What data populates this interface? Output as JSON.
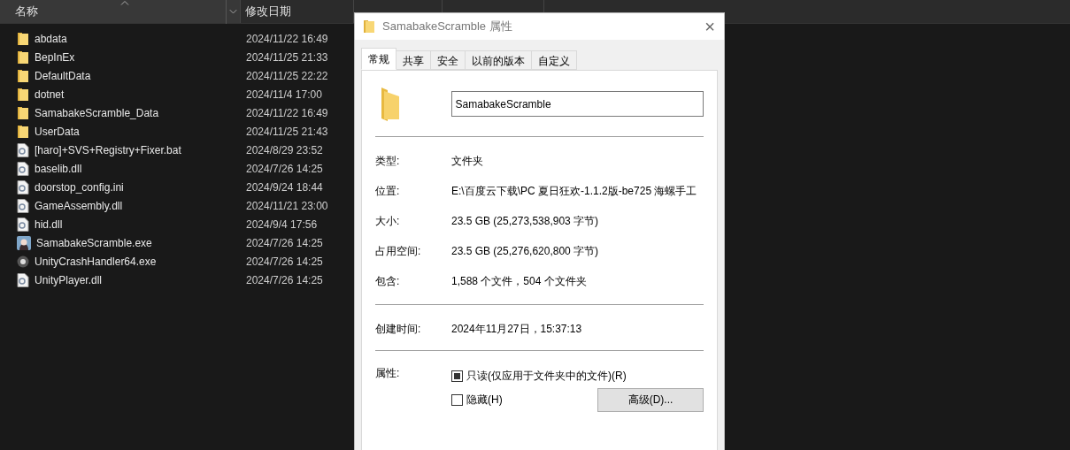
{
  "explorer": {
    "columns": [
      {
        "label": "名称",
        "sorted": true
      },
      {
        "label": "修改日期",
        "sorted": false
      }
    ],
    "rows": [
      {
        "kind": "folder",
        "name": "abdata",
        "modified": "2024/11/22 16:49"
      },
      {
        "kind": "folder",
        "name": "BepInEx",
        "modified": "2024/11/25 21:33"
      },
      {
        "kind": "folder",
        "name": "DefaultData",
        "modified": "2024/11/25 22:22"
      },
      {
        "kind": "folder",
        "name": "dotnet",
        "modified": "2024/11/4 17:00"
      },
      {
        "kind": "folder",
        "name": "SamabakeScramble_Data",
        "modified": "2024/11/22 16:49"
      },
      {
        "kind": "folder",
        "name": "UserData",
        "modified": "2024/11/25 21:43"
      },
      {
        "kind": "script",
        "name": "[haro]+SVS+Registry+Fixer.bat",
        "modified": "2024/8/29 23:52"
      },
      {
        "kind": "library",
        "name": "baselib.dll",
        "modified": "2024/7/26 14:25"
      },
      {
        "kind": "settings",
        "name": "doorstop_config.ini",
        "modified": "2024/9/24 18:44"
      },
      {
        "kind": "library",
        "name": "GameAssembly.dll",
        "modified": "2024/11/21 23:00"
      },
      {
        "kind": "library",
        "name": "hid.dll",
        "modified": "2024/9/4 17:56"
      },
      {
        "kind": "app",
        "name": "SamabakeScramble.exe",
        "modified": "2024/7/26 14:25"
      },
      {
        "kind": "handler",
        "name": "UnityCrashHandler64.exe",
        "modified": "2024/7/26 14:25"
      },
      {
        "kind": "library",
        "name": "UnityPlayer.dll",
        "modified": "2024/7/26 14:25"
      }
    ]
  },
  "dialog": {
    "title": "SamabakeScramble 属性",
    "close": "×",
    "tabs": [
      {
        "label": "常规",
        "selected": true
      },
      {
        "label": "共享",
        "selected": false
      },
      {
        "label": "安全",
        "selected": false
      },
      {
        "label": "以前的版本",
        "selected": false
      },
      {
        "label": "自定义",
        "selected": false
      }
    ],
    "name_value": "SamabakeScramble",
    "groups": [
      [
        {
          "label": "类型:",
          "value": "文件夹"
        },
        {
          "label": "位置:",
          "value": "E:\\百度云下载\\PC 夏日狂欢-1.1.2版-be725 海螺手工"
        },
        {
          "label": "大小:",
          "value": "23.5 GB (25,273,538,903 字节)"
        },
        {
          "label": "占用空间:",
          "value": "23.5 GB (25,276,620,800 字节)"
        },
        {
          "label": "包含:",
          "value": "1,588 个文件，504 个文件夹"
        }
      ],
      [
        {
          "label": "创建时间:",
          "value": "2024年11月27日，15:37:13"
        }
      ]
    ],
    "attributes_label": "属性:",
    "attributes": [
      {
        "label": "只读(仅应用于文件夹中的文件)(R)",
        "checked": true
      },
      {
        "label": "隐藏(H)",
        "checked": false
      }
    ],
    "advanced_button": "高级(D)..."
  }
}
